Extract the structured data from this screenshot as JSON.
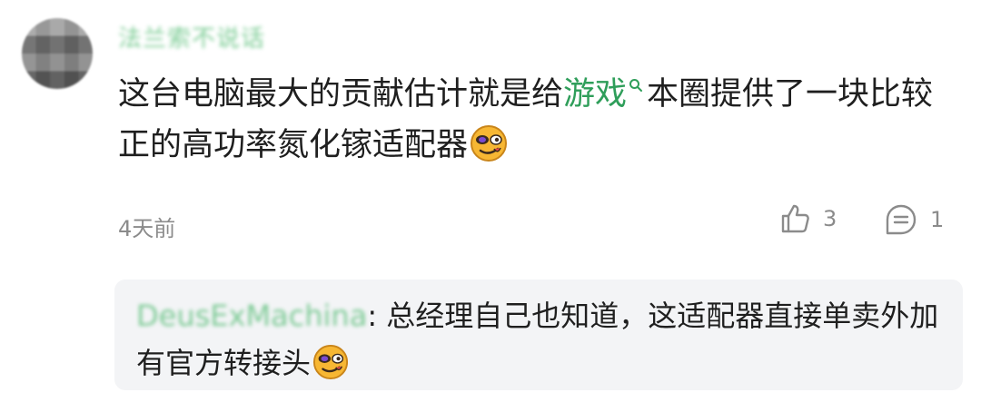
{
  "comment": {
    "username": "法兰索不说话",
    "text_before_link": "这台电脑最大的贡献估计就是给",
    "link_text": "游戏",
    "text_after_link": "本圈提供了一块比较正的高功率氮化镓适配器",
    "time": "4天前",
    "likes": "3",
    "replies": "1"
  },
  "reply": {
    "username": "DeusExMachina",
    "colon": ":",
    "text": " 总经理自己也知道，这适配器直接单卖外加有官方转接头"
  },
  "icons": {
    "like": "thumbs-up-icon",
    "comment": "comment-bubble-icon",
    "search": "search-icon",
    "emoji": "smirk-emoji-icon"
  },
  "colors": {
    "link": "#2f9e5a",
    "username": "#48b86a",
    "meta": "#8b8b8b",
    "reply_bg": "#f3f4f6"
  }
}
